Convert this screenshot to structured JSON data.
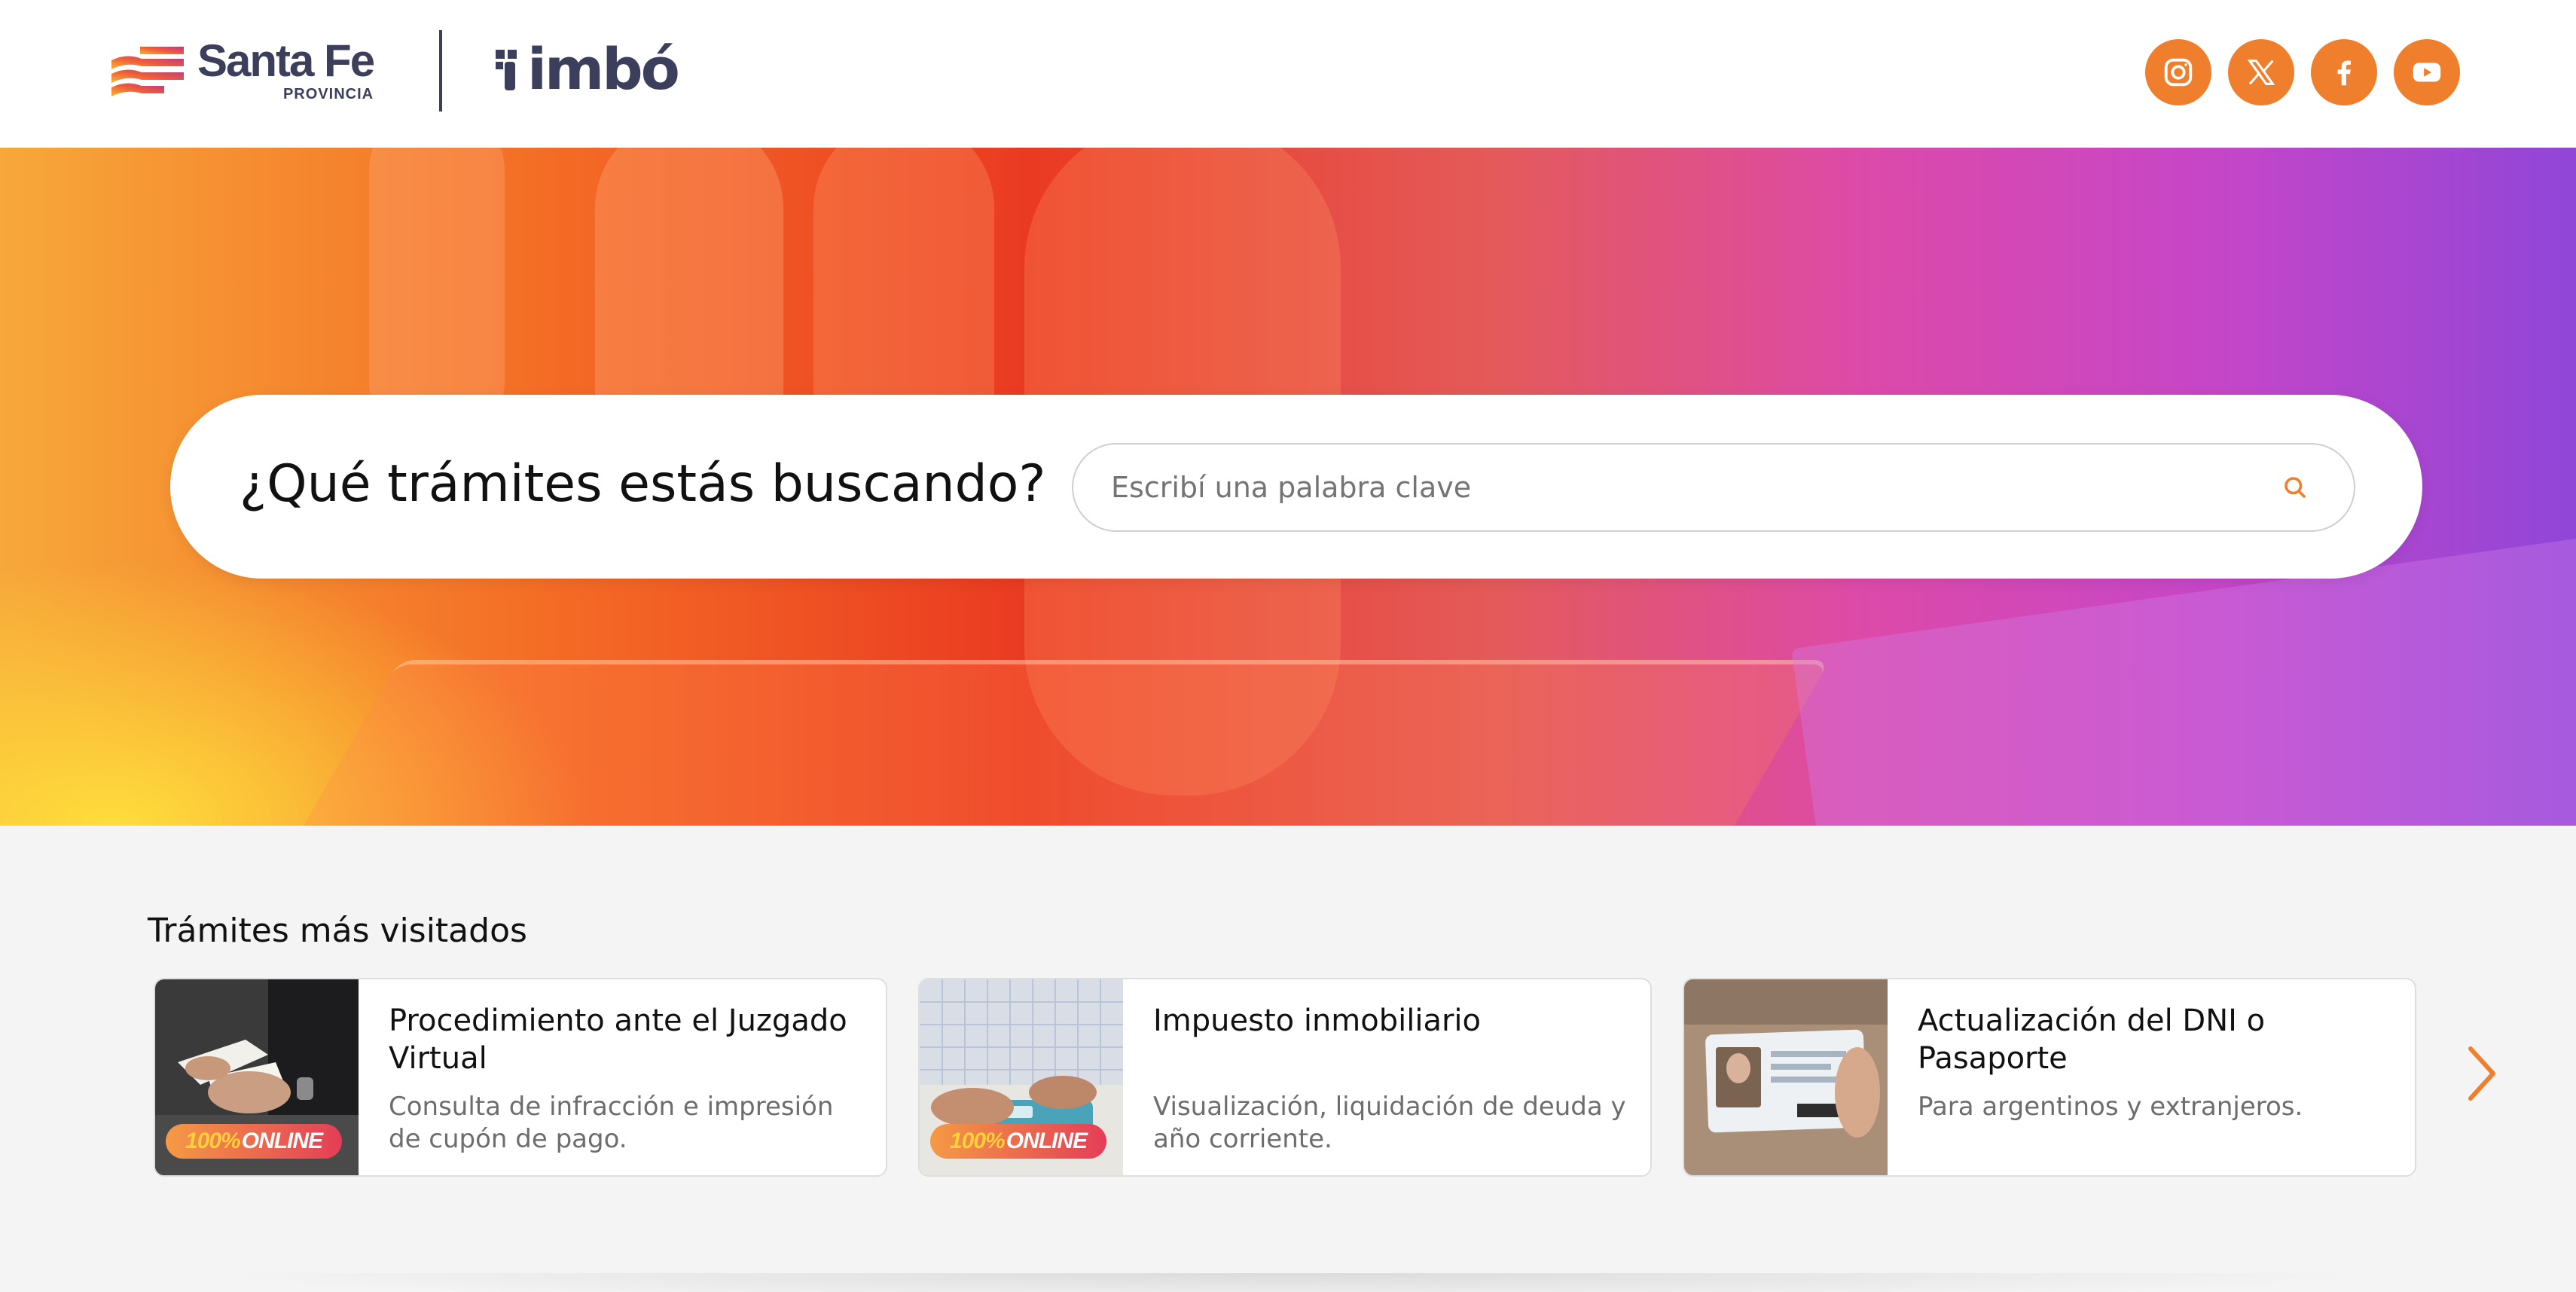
{
  "header": {
    "brand_name": "Santa Fe",
    "brand_sub": "PROVINCIA",
    "product_name": "imbó",
    "socials": [
      {
        "icon": "instagram-icon"
      },
      {
        "icon": "x-icon"
      },
      {
        "icon": "facebook-icon"
      },
      {
        "icon": "youtube-icon"
      }
    ]
  },
  "hero": {
    "search_title": "¿Qué trámites estás buscando?",
    "search_placeholder": "Escribí una palabra clave"
  },
  "most_visited": {
    "title": "Trámites más visitados",
    "cards": [
      {
        "title": "Procedimiento ante el Juzgado Virtual",
        "description": "Consulta de infracción e impresión de cupón de pago.",
        "badge_num": "100%",
        "badge_text": "ONLINE"
      },
      {
        "title": "Impuesto inmobiliario",
        "description": "Visualización, liquidación de deuda y año corriente.",
        "badge_num": "100%",
        "badge_text": "ONLINE"
      },
      {
        "title": "Actualización del DNI o Pasaporte",
        "description": "Para argentinos y extranjeros."
      }
    ]
  },
  "colors": {
    "accent": "#ef7f2c",
    "brand_text": "#3b3f5c",
    "section_bg": "#f4f4f4"
  }
}
